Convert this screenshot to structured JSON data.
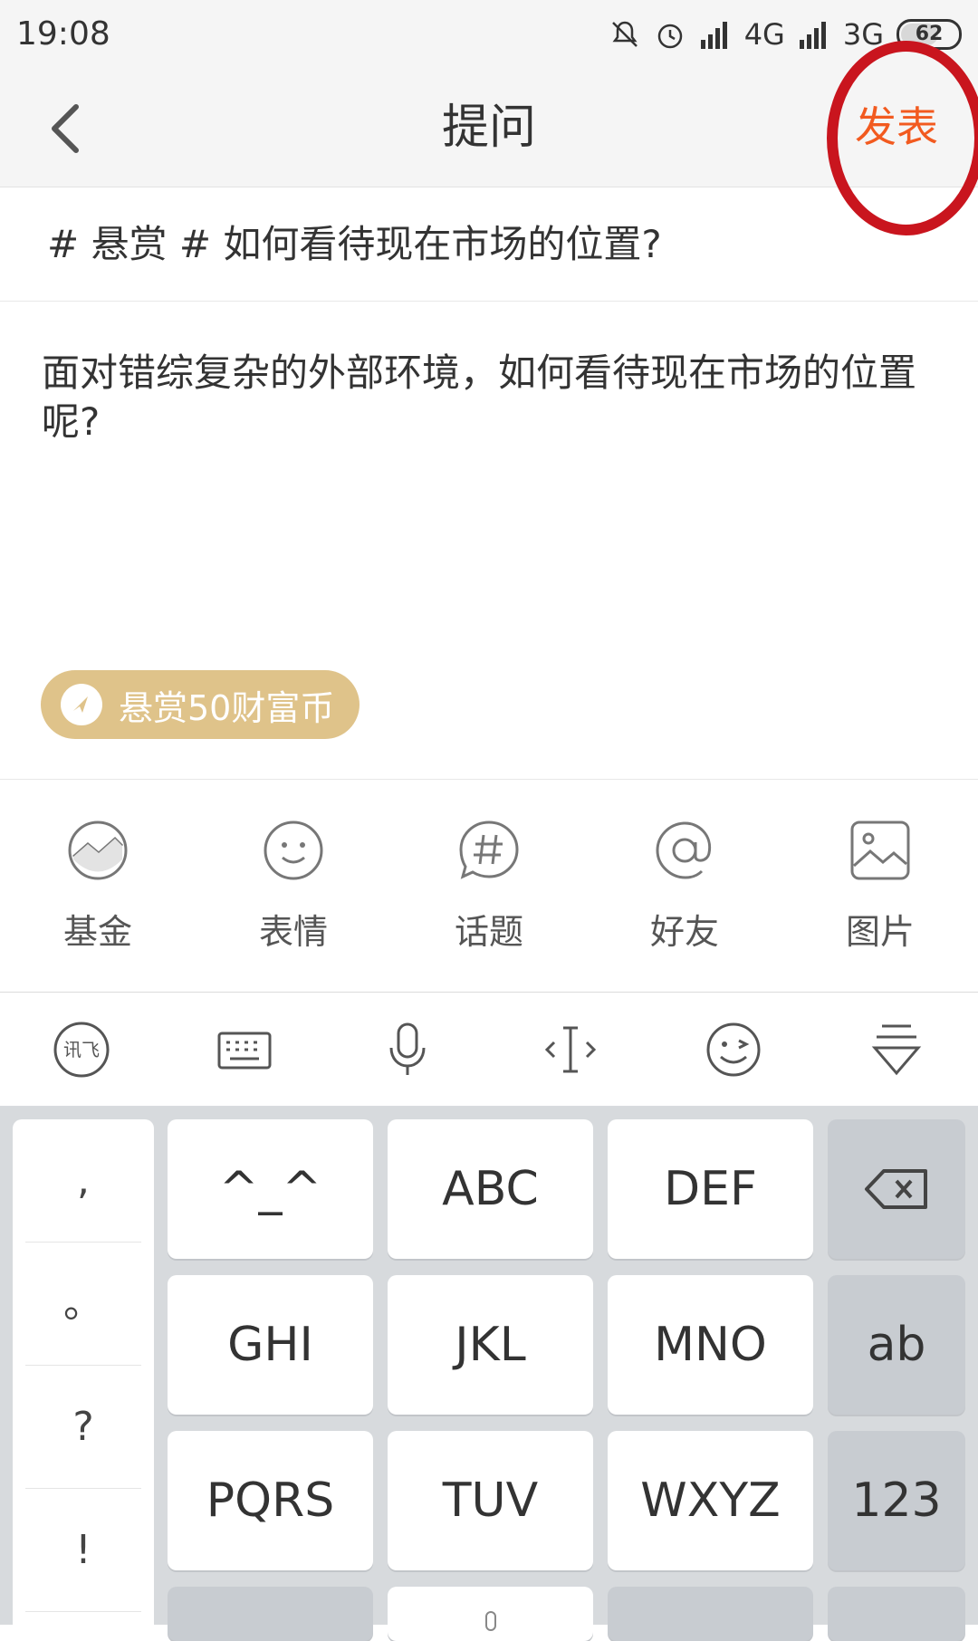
{
  "status_bar": {
    "time": "19:08",
    "network_1": "4G",
    "network_2": "3G",
    "battery": "62"
  },
  "nav": {
    "title": "提问",
    "publish": "发表"
  },
  "question": {
    "title": "# 悬赏 # 如何看待现在市场的位置?",
    "body": "面对错综复杂的外部环境，如何看待现在市场的位置呢?"
  },
  "reward": {
    "label": "悬赏50财富币"
  },
  "tools": [
    {
      "label": "基金",
      "icon": "fund-chart-icon"
    },
    {
      "label": "表情",
      "icon": "smiley-icon"
    },
    {
      "label": "话题",
      "icon": "topic-hash-icon"
    },
    {
      "label": "好友",
      "icon": "at-icon"
    },
    {
      "label": "图片",
      "icon": "image-icon"
    }
  ],
  "keyboard": {
    "punct": [
      ",",
      "。",
      "?",
      "!"
    ],
    "row1": [
      "^_^",
      "ABC",
      "DEF"
    ],
    "row2": [
      "GHI",
      "JKL",
      "MNO"
    ],
    "row3": [
      "PQRS",
      "TUV",
      "WXYZ"
    ],
    "side": [
      "ab",
      "123"
    ]
  }
}
